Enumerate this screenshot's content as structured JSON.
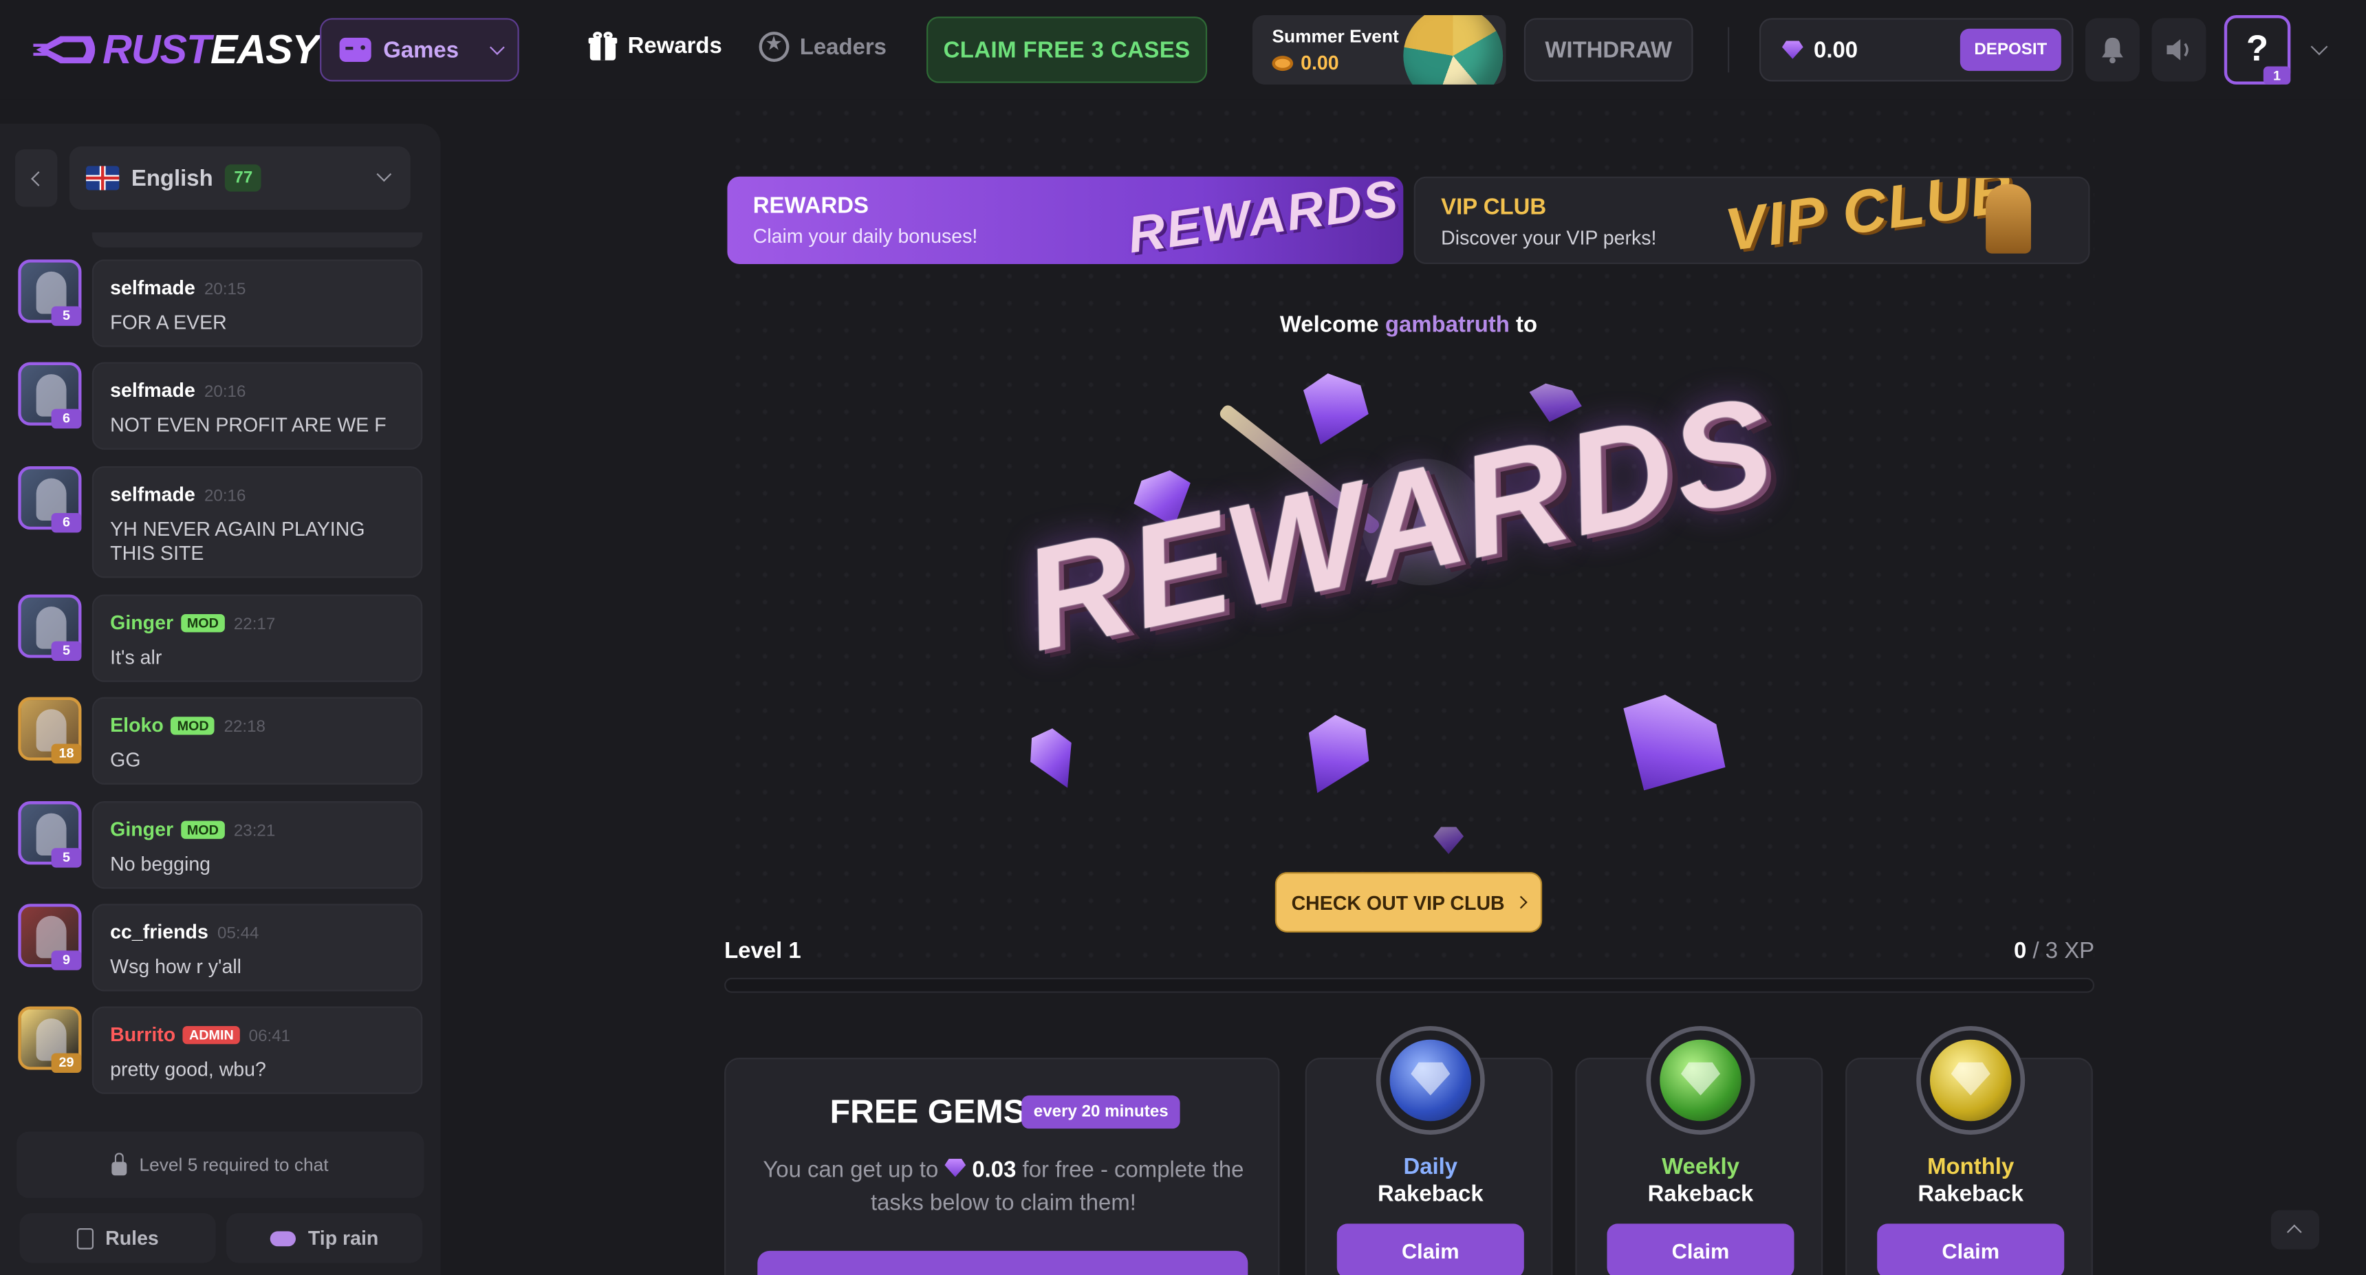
{
  "header": {
    "logo_left": "RUST",
    "logo_right": "EASY",
    "games_label": "Games",
    "nav_rewards": "Rewards",
    "nav_leaders": "Leaders",
    "claim_label": "CLAIM FREE 3 CASES",
    "event_title": "Summer Event",
    "event_value": "0.00",
    "withdraw_label": "WITHDRAW",
    "balance": "0.00",
    "deposit_label": "DEPOSIT",
    "help_label": "?",
    "help_badge": "1"
  },
  "sidebar": {
    "language": "English",
    "online_count": "77",
    "messages": [
      {
        "user": "selfmade",
        "role": "",
        "time": "20:15",
        "text": "FOR A EVER",
        "level": "5",
        "avatar": "default"
      },
      {
        "user": "selfmade",
        "role": "",
        "time": "20:16",
        "text": "NOT EVEN PROFIT ARE WE F",
        "level": "6",
        "avatar": "default"
      },
      {
        "user": "selfmade",
        "role": "",
        "time": "20:16",
        "text": "YH NEVER AGAIN PLAYING THIS SITE",
        "level": "6",
        "avatar": "default"
      },
      {
        "user": "Ginger",
        "role": "MOD",
        "time": "22:17",
        "text": "It's alr",
        "level": "5",
        "avatar": "default"
      },
      {
        "user": "Eloko",
        "role": "MOD",
        "time": "22:18",
        "text": "GG",
        "level": "18",
        "avatar": "orange"
      },
      {
        "user": "Ginger",
        "role": "MOD",
        "time": "23:21",
        "text": "No begging",
        "level": "5",
        "avatar": "default"
      },
      {
        "user": "cc_friends",
        "role": "",
        "time": "05:44",
        "text": "Wsg how r y'all",
        "level": "9",
        "avatar": "red"
      },
      {
        "user": "Burrito",
        "role": "ADMIN",
        "time": "06:41",
        "text": "pretty good, wbu?",
        "level": "29",
        "avatar": "gold"
      }
    ],
    "chat_locked": "Level 5 required to chat",
    "rules_label": "Rules",
    "tiprain_label": "Tip rain"
  },
  "main": {
    "banner_rewards_title": "REWARDS",
    "banner_rewards_sub": "Claim your daily bonuses!",
    "banner_rewards_art": "REWARDS",
    "banner_vip_title": "VIP CLUB",
    "banner_vip_sub": "Discover your VIP perks!",
    "banner_vip_art": "VIP CLUB",
    "welcome_prefix": "Welcome",
    "welcome_user": "gambatruth",
    "welcome_suffix": "to",
    "hero_word": "REWARDS",
    "vip_cta": "CHECK OUT VIP CLUB",
    "level_label": "Level 1",
    "xp_current": "0",
    "xp_total": "/ 3 XP",
    "xp_progress": 0,
    "free_title": "FREE GEMS",
    "free_badge": "every 20 minutes",
    "free_desc_1": "You can get up to",
    "free_amount": "0.03",
    "free_desc_2": "for free - complete the tasks below to claim them!",
    "rakeback": [
      {
        "name": "Daily",
        "sub": "Rakeback",
        "button": "Claim"
      },
      {
        "name": "Weekly",
        "sub": "Rakeback",
        "button": "Claim"
      },
      {
        "name": "Monthly",
        "sub": "Rakeback",
        "button": "Claim"
      }
    ]
  },
  "colors": {
    "accent": "#8a4fd4",
    "mod": "#7ee36a",
    "admin": "#e34848",
    "claim_green": "#6ee07b",
    "vip_gold": "#f2c261"
  }
}
